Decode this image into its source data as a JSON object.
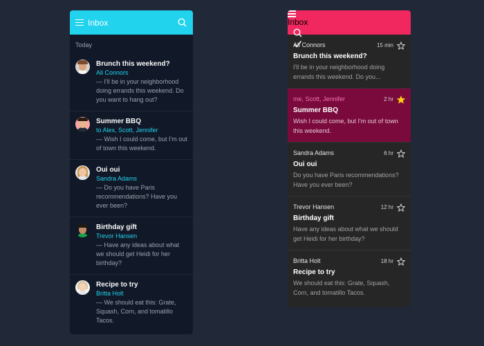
{
  "left": {
    "title": "Inbox",
    "section": "Today",
    "items": [
      {
        "subject": "Brunch this weekend?",
        "from": "Ali Connors",
        "snippet": "— I'll be in your neighborhood doing errands this weekend. Do you want to hang out?"
      },
      {
        "subject": "Summer BBQ",
        "from": "to Alex, Scott, Jennifer",
        "snippet": "— Wish I could come, but I'm out of town this weekend."
      },
      {
        "subject": "Oui oui",
        "from": "Sandra Adams",
        "snippet": "— Do you have Paris recommendations? Have you ever been?"
      },
      {
        "subject": "Birthday gift",
        "from": "Trevor Hansen",
        "snippet": "— Have any ideas about what we should get Heidi for her birthday?"
      },
      {
        "subject": "Recipe to try",
        "from": "Britta Holt",
        "snippet": "— We should eat this: Grate, Squash, Corn, and tomatillo Tacos."
      }
    ]
  },
  "right": {
    "title": "Inbox",
    "items": [
      {
        "name": "Ali Connors",
        "time": "15 min",
        "subject": "Brunch this weekend?",
        "snippet": "I'll be in your neighborhood doing errands this weekend. Do you..."
      },
      {
        "name": "me, Scott, Jennifer",
        "time": "2 hr",
        "subject": "Summer BBQ",
        "snippet": "Wish I could come, but I'm out of town this weekend."
      },
      {
        "name": "Sandra Adams",
        "time": "6 hr",
        "subject": "Oui oui",
        "snippet": "Do you have Paris recommendations? Have you ever been?"
      },
      {
        "name": "Trevor Hansen",
        "time": "12 hr",
        "subject": "Birthday gift",
        "snippet": "Have any ideas about what we should get Heidi for her birthday?"
      },
      {
        "name": "Britta Holt",
        "time": "18 hr",
        "subject": "Recipe to try",
        "snippet": "We should eat this: Grate, Squash, Corn, and tomatillo Tacos."
      }
    ]
  },
  "colors": {
    "background": "#212837",
    "left_accent": "#22d3ee",
    "right_accent": "#f0285f",
    "selected_row": "#7a0a3c",
    "star_filled": "#facc15"
  },
  "icons": {
    "menu": "menu-icon",
    "search": "search-icon",
    "check": "check-icon",
    "star_outline": "star-outline-icon",
    "star_filled": "star-filled-icon"
  }
}
